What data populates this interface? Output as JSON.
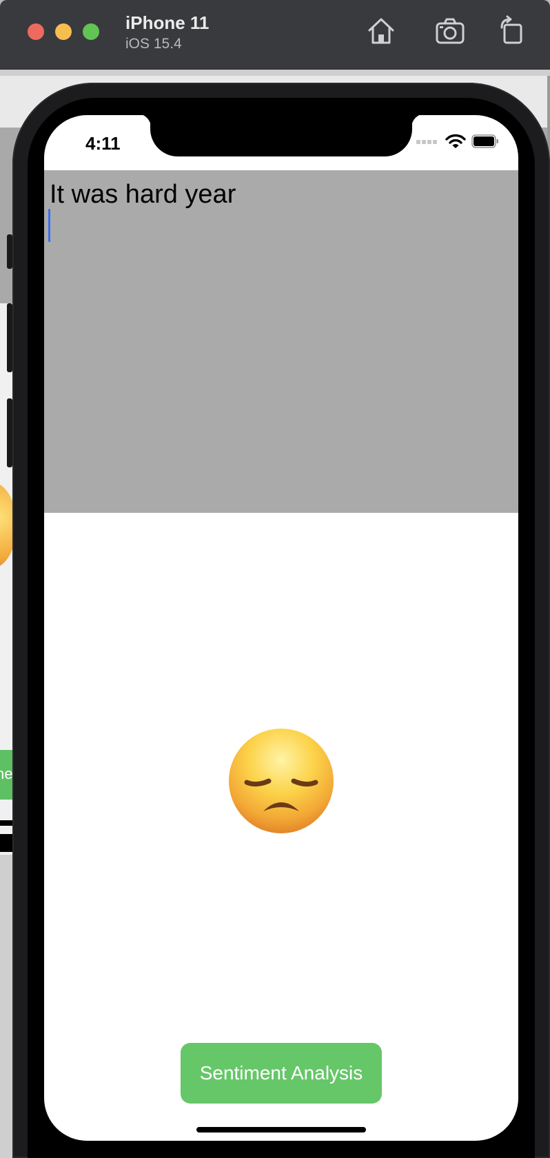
{
  "titlebar": {
    "device_name": "iPhone 11",
    "os_version": "iOS 15.4",
    "icons": [
      "home-icon",
      "screenshot-icon",
      "rotate-icon"
    ]
  },
  "status_bar": {
    "time": "4:11",
    "icons": [
      "cellular-icon",
      "wifi-icon",
      "battery-icon"
    ]
  },
  "text_input": {
    "value": "It was hard year",
    "background": "#aaaaaa"
  },
  "result": {
    "emoji": "disappointed-face-icon"
  },
  "button": {
    "label": "Sentiment Analysis",
    "color": "#66c768"
  },
  "background_window": {
    "button_fragment": "ne"
  }
}
